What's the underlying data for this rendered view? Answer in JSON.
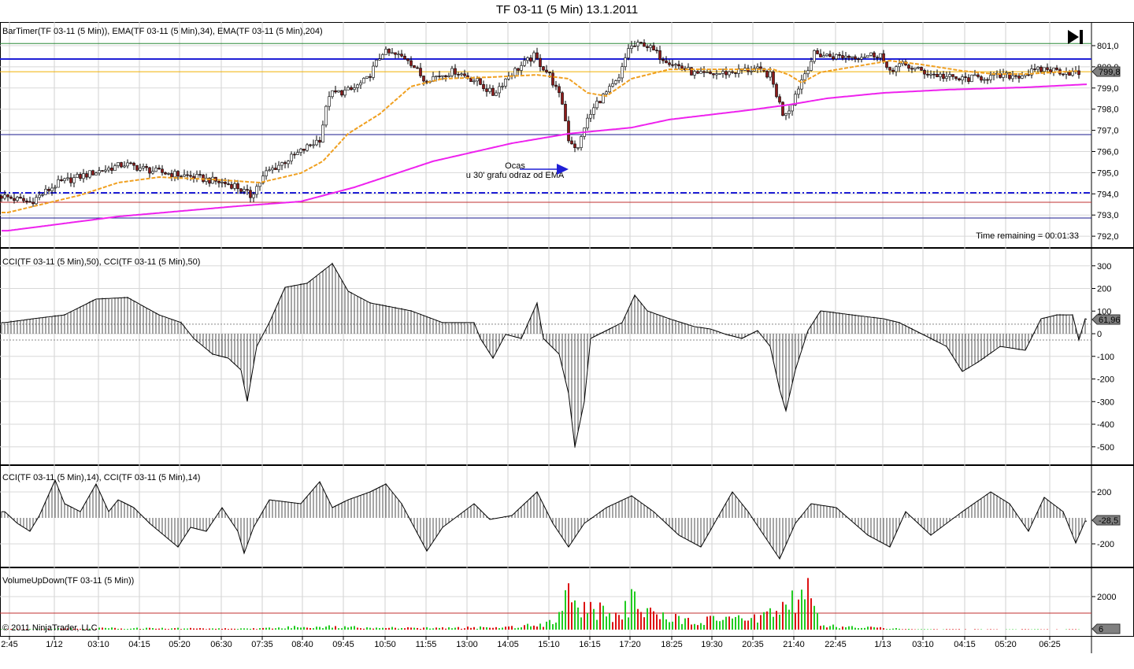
{
  "window_title": "TF 03-11 (5 Min)  13.1.2011",
  "chart_data": [
    {
      "type": "candlestick",
      "panel": "price",
      "label": "BarTimer(TF 03-11 (5 Min)), EMA(TF 03-11 (5 Min),34), EMA(TF 03-11 (5 Min),204)",
      "yticks": [
        "801,0",
        "800,0",
        "799,0",
        "798,0",
        "797,0",
        "796,0",
        "795,0",
        "794,0",
        "793,0",
        "792,0"
      ],
      "ylim": [
        791.6,
        801.5
      ],
      "last_price": "799,8",
      "close_keypoints": [
        [
          1,
          793.9
        ],
        [
          10,
          793.6
        ],
        [
          19,
          794.5
        ],
        [
          30,
          795.0
        ],
        [
          40,
          795.4
        ],
        [
          50,
          795.05
        ],
        [
          62,
          794.8
        ],
        [
          75,
          794.4
        ],
        [
          80,
          793.9
        ],
        [
          85,
          795.0
        ],
        [
          95,
          795.9
        ],
        [
          102,
          796.6
        ],
        [
          105,
          798.7
        ],
        [
          112,
          798.9
        ],
        [
          117,
          799.4
        ],
        [
          122,
          800.7
        ],
        [
          130,
          800.4
        ],
        [
          135,
          799.4
        ],
        [
          145,
          799.8
        ],
        [
          152,
          799.3
        ],
        [
          157,
          798.7
        ],
        [
          162,
          799.6
        ],
        [
          170,
          800.5
        ],
        [
          175,
          799.6
        ],
        [
          179,
          798.3
        ],
        [
          181,
          796.6
        ],
        [
          184,
          796.1
        ],
        [
          186,
          797.2
        ],
        [
          190,
          798.3
        ],
        [
          197,
          799.4
        ],
        [
          200,
          800.9
        ],
        [
          205,
          801.1
        ],
        [
          210,
          800.5
        ],
        [
          215,
          800.1
        ],
        [
          222,
          799.6
        ],
        [
          230,
          799.7
        ],
        [
          240,
          799.9
        ],
        [
          245,
          799.6
        ],
        [
          249,
          797.8
        ],
        [
          251,
          798.0
        ],
        [
          255,
          799.4
        ],
        [
          259,
          800.6
        ],
        [
          265,
          800.5
        ],
        [
          272,
          800.5
        ],
        [
          280,
          800.6
        ],
        [
          282,
          799.8
        ],
        [
          287,
          800.1
        ],
        [
          295,
          799.7
        ],
        [
          305,
          799.4
        ],
        [
          312,
          799.5
        ],
        [
          324,
          799.6
        ],
        [
          332,
          799.9
        ],
        [
          342,
          799.7
        ]
      ],
      "ema34_keypoints": [
        [
          2,
          793.12
        ],
        [
          25,
          793.94
        ],
        [
          37,
          794.53
        ],
        [
          50,
          794.79
        ],
        [
          67,
          794.68
        ],
        [
          82,
          794.53
        ],
        [
          95,
          794.98
        ],
        [
          102,
          795.54
        ],
        [
          110,
          796.84
        ],
        [
          120,
          797.77
        ],
        [
          130,
          799.07
        ],
        [
          140,
          799.44
        ],
        [
          155,
          799.51
        ],
        [
          170,
          799.62
        ],
        [
          180,
          799.44
        ],
        [
          186,
          798.77
        ],
        [
          192,
          798.62
        ],
        [
          200,
          799.44
        ],
        [
          212,
          799.88
        ],
        [
          230,
          799.88
        ],
        [
          245,
          799.88
        ],
        [
          250,
          799.62
        ],
        [
          254,
          799.25
        ],
        [
          260,
          799.74
        ],
        [
          270,
          799.99
        ],
        [
          282,
          800.29
        ],
        [
          292,
          800.11
        ],
        [
          305,
          799.81
        ],
        [
          315,
          799.66
        ],
        [
          325,
          799.66
        ],
        [
          342,
          799.81
        ]
      ],
      "ema204_keypoints": [
        [
          2,
          792.26
        ],
        [
          37,
          792.93
        ],
        [
          75,
          793.42
        ],
        [
          95,
          793.64
        ],
        [
          112,
          794.31
        ],
        [
          137,
          795.54
        ],
        [
          162,
          796.39
        ],
        [
          180,
          796.84
        ],
        [
          200,
          797.13
        ],
        [
          212,
          797.51
        ],
        [
          237,
          797.95
        ],
        [
          250,
          798.21
        ],
        [
          262,
          798.51
        ],
        [
          280,
          798.77
        ],
        [
          300,
          798.92
        ],
        [
          325,
          799.03
        ],
        [
          345,
          799.18
        ]
      ],
      "horizontal_lines": [
        {
          "price": 801.1,
          "color": "#2e8b3a",
          "style": "solid"
        },
        {
          "price": 800.37,
          "color": "#1f1fd6",
          "style": "thick"
        },
        {
          "price": 799.77,
          "color": "#f0b000",
          "style": "solid"
        },
        {
          "price": 796.8,
          "color": "#1a1a8c",
          "style": "solid"
        },
        {
          "price": 794.05,
          "color": "#1f1fd6",
          "style": "dashdot"
        },
        {
          "price": 793.6,
          "color": "#c03030",
          "style": "solid"
        },
        {
          "price": 792.86,
          "color": "#1a1a8c",
          "style": "solid"
        }
      ],
      "annotation": {
        "line1": "Ocas",
        "line2": "u 30' grafu odraz od EMA"
      },
      "time_remaining": "Time remaining = 00:01:33"
    },
    {
      "type": "histogram",
      "panel": "cci50",
      "label": "CCI(TF 03-11 (5 Min),50), CCI(TF 03-11 (5 Min),50)",
      "yticks": [
        "300",
        "200",
        "100",
        "0",
        "-100",
        "-200",
        "-300",
        "-400",
        "-500"
      ],
      "last_value": "61,96",
      "keypoints": [
        [
          1,
          49
        ],
        [
          10,
          66
        ],
        [
          20,
          83
        ],
        [
          30,
          153
        ],
        [
          40,
          160
        ],
        [
          50,
          83
        ],
        [
          57,
          49
        ],
        [
          61,
          -21
        ],
        [
          67,
          -90
        ],
        [
          72,
          -108
        ],
        [
          76,
          -160
        ],
        [
          78,
          -299
        ],
        [
          81,
          -56
        ],
        [
          85,
          49
        ],
        [
          90,
          205
        ],
        [
          97,
          223
        ],
        [
          105,
          310
        ],
        [
          110,
          188
        ],
        [
          117,
          136
        ],
        [
          130,
          101
        ],
        [
          140,
          49
        ],
        [
          150,
          49
        ],
        [
          152,
          -21
        ],
        [
          156,
          -108
        ],
        [
          160,
          -3
        ],
        [
          165,
          -21
        ],
        [
          170,
          136
        ],
        [
          172,
          -21
        ],
        [
          177,
          -90
        ],
        [
          180,
          -264
        ],
        [
          182,
          -500
        ],
        [
          185,
          -299
        ],
        [
          187,
          -21
        ],
        [
          197,
          49
        ],
        [
          201,
          170
        ],
        [
          205,
          101
        ],
        [
          212,
          66
        ],
        [
          220,
          31
        ],
        [
          225,
          21
        ],
        [
          230,
          -3
        ],
        [
          235,
          -21
        ],
        [
          240,
          14
        ],
        [
          244,
          -56
        ],
        [
          247,
          -247
        ],
        [
          249,
          -341
        ],
        [
          252,
          -160
        ],
        [
          256,
          14
        ],
        [
          260,
          101
        ],
        [
          270,
          83
        ],
        [
          280,
          66
        ],
        [
          285,
          49
        ],
        [
          295,
          -21
        ],
        [
          300,
          -56
        ],
        [
          305,
          -167
        ],
        [
          310,
          -125
        ],
        [
          317,
          -56
        ],
        [
          325,
          -73
        ],
        [
          330,
          66
        ],
        [
          335,
          83
        ],
        [
          340,
          83
        ],
        [
          342,
          -28
        ],
        [
          344,
          66
        ],
        [
          345,
          62
        ]
      ]
    },
    {
      "type": "histogram",
      "panel": "cci14",
      "label": "CCI(TF 03-11 (5 Min),14), CCI(TF 03-11 (5 Min),14)",
      "yticks": [
        "200",
        "-200"
      ],
      "last_value": "-28,5",
      "keypoints": [
        [
          1,
          48
        ],
        [
          5,
          -42
        ],
        [
          9,
          -103
        ],
        [
          12,
          18
        ],
        [
          17,
          291
        ],
        [
          20,
          109
        ],
        [
          25,
          48
        ],
        [
          30,
          261
        ],
        [
          34,
          48
        ],
        [
          37,
          139
        ],
        [
          42,
          79
        ],
        [
          47,
          -42
        ],
        [
          56,
          -224
        ],
        [
          60,
          -73
        ],
        [
          65,
          -103
        ],
        [
          70,
          79
        ],
        [
          75,
          -103
        ],
        [
          77,
          -273
        ],
        [
          80,
          -73
        ],
        [
          85,
          139
        ],
        [
          95,
          109
        ],
        [
          101,
          279
        ],
        [
          105,
          79
        ],
        [
          110,
          139
        ],
        [
          117,
          200
        ],
        [
          122,
          261
        ],
        [
          127,
          109
        ],
        [
          135,
          -255
        ],
        [
          140,
          -73
        ],
        [
          150,
          109
        ],
        [
          155,
          -12
        ],
        [
          162,
          18
        ],
        [
          170,
          200
        ],
        [
          175,
          -42
        ],
        [
          180,
          -224
        ],
        [
          185,
          -42
        ],
        [
          192,
          79
        ],
        [
          200,
          170
        ],
        [
          207,
          48
        ],
        [
          215,
          -133
        ],
        [
          222,
          -224
        ],
        [
          232,
          200
        ],
        [
          237,
          48
        ],
        [
          247,
          -315
        ],
        [
          252,
          -42
        ],
        [
          257,
          109
        ],
        [
          265,
          79
        ],
        [
          275,
          -133
        ],
        [
          282,
          -224
        ],
        [
          287,
          48
        ],
        [
          295,
          -133
        ],
        [
          305,
          48
        ],
        [
          314,
          200
        ],
        [
          320,
          109
        ],
        [
          326,
          -103
        ],
        [
          331,
          158
        ],
        [
          337,
          48
        ],
        [
          341,
          -194
        ],
        [
          344,
          -24
        ],
        [
          345,
          -28
        ]
      ]
    },
    {
      "type": "bar",
      "panel": "volume",
      "label": "VolumeUpDown(TF 03-11 (5 Min))",
      "yticks": [
        "2000"
      ],
      "last_value": "6",
      "reference_line": 1000,
      "envelope_keypoints": [
        [
          0,
          40
        ],
        [
          35,
          120
        ],
        [
          80,
          80
        ],
        [
          100,
          250
        ],
        [
          110,
          200
        ],
        [
          130,
          120
        ],
        [
          160,
          180
        ],
        [
          172,
          500
        ],
        [
          177,
          1200
        ],
        [
          179,
          3300
        ],
        [
          182,
          2700
        ],
        [
          185,
          1500
        ],
        [
          195,
          1300
        ],
        [
          200,
          2100
        ],
        [
          210,
          900
        ],
        [
          230,
          700
        ],
        [
          240,
          900
        ],
        [
          246,
          1800
        ],
        [
          247,
          2600
        ],
        [
          252,
          2100
        ],
        [
          256,
          3000
        ],
        [
          260,
          300
        ],
        [
          290,
          30
        ],
        [
          345,
          20
        ]
      ]
    }
  ],
  "time_axis": [
    "2:45",
    "1/12",
    "03:10",
    "04:15",
    "05:20",
    "06:30",
    "07:35",
    "08:40",
    "09:45",
    "10:50",
    "11:55",
    "13:00",
    "14:05",
    "15:10",
    "16:15",
    "17:20",
    "18:25",
    "19:30",
    "20:35",
    "21:40",
    "22:45",
    "1/13",
    "03:10",
    "04:15",
    "05:20",
    "06:25"
  ],
  "copyright": "© 2011 NinjaTrader, LLC",
  "colors": {
    "up": "#22cc22",
    "down": "#dd1111",
    "ema34": "#f0a020",
    "ema204": "#ee22ee",
    "pointer": "#808080"
  }
}
